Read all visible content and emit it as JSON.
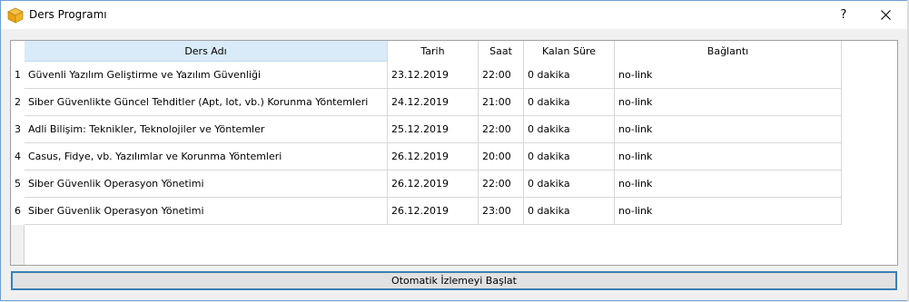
{
  "window": {
    "title": "Ders Programı",
    "help_label": "?",
    "icons": {
      "app": "package-icon",
      "close": "close-icon"
    }
  },
  "table": {
    "columns": [
      "Ders Adı",
      "Tarih",
      "Saat",
      "Kalan Süre",
      "Bağlantı"
    ],
    "rows": [
      {
        "num": "1",
        "ders": "Güvenli Yazılım Geliştirme ve Yazılım Güvenliği",
        "tarih": "23.12.2019",
        "saat": "22:00",
        "kalan": "0 dakika",
        "baglanti": "no-link"
      },
      {
        "num": "2",
        "ders": "Siber Güvenlikte Güncel Tehditler (Apt, Iot, vb.) Korunma Yöntemleri",
        "tarih": "24.12.2019",
        "saat": "21:00",
        "kalan": "0 dakika",
        "baglanti": "no-link"
      },
      {
        "num": "3",
        "ders": "Adli Bilişim: Teknikler, Teknolojiler ve Yöntemler",
        "tarih": "25.12.2019",
        "saat": "22:00",
        "kalan": "0 dakika",
        "baglanti": "no-link"
      },
      {
        "num": "4",
        "ders": "Casus, Fidye, vb. Yazılımlar ve Korunma Yöntemleri",
        "tarih": "26.12.2019",
        "saat": "20:00",
        "kalan": "0 dakika",
        "baglanti": "no-link"
      },
      {
        "num": "5",
        "ders": "Siber Güvenlik Operasyon Yönetimi",
        "tarih": "26.12.2019",
        "saat": "22:00",
        "kalan": "0 dakika",
        "baglanti": "no-link"
      },
      {
        "num": "6",
        "ders": "Siber Güvenlik Operasyon Yönetimi",
        "tarih": "26.12.2019",
        "saat": "23:00",
        "kalan": "0 dakika",
        "baglanti": "no-link"
      }
    ]
  },
  "actions": {
    "start_label": "Otomatik İzlemeyi Başlat"
  },
  "colors": {
    "accent": "#3c7fb1",
    "header_active": "#d9ebf9"
  }
}
